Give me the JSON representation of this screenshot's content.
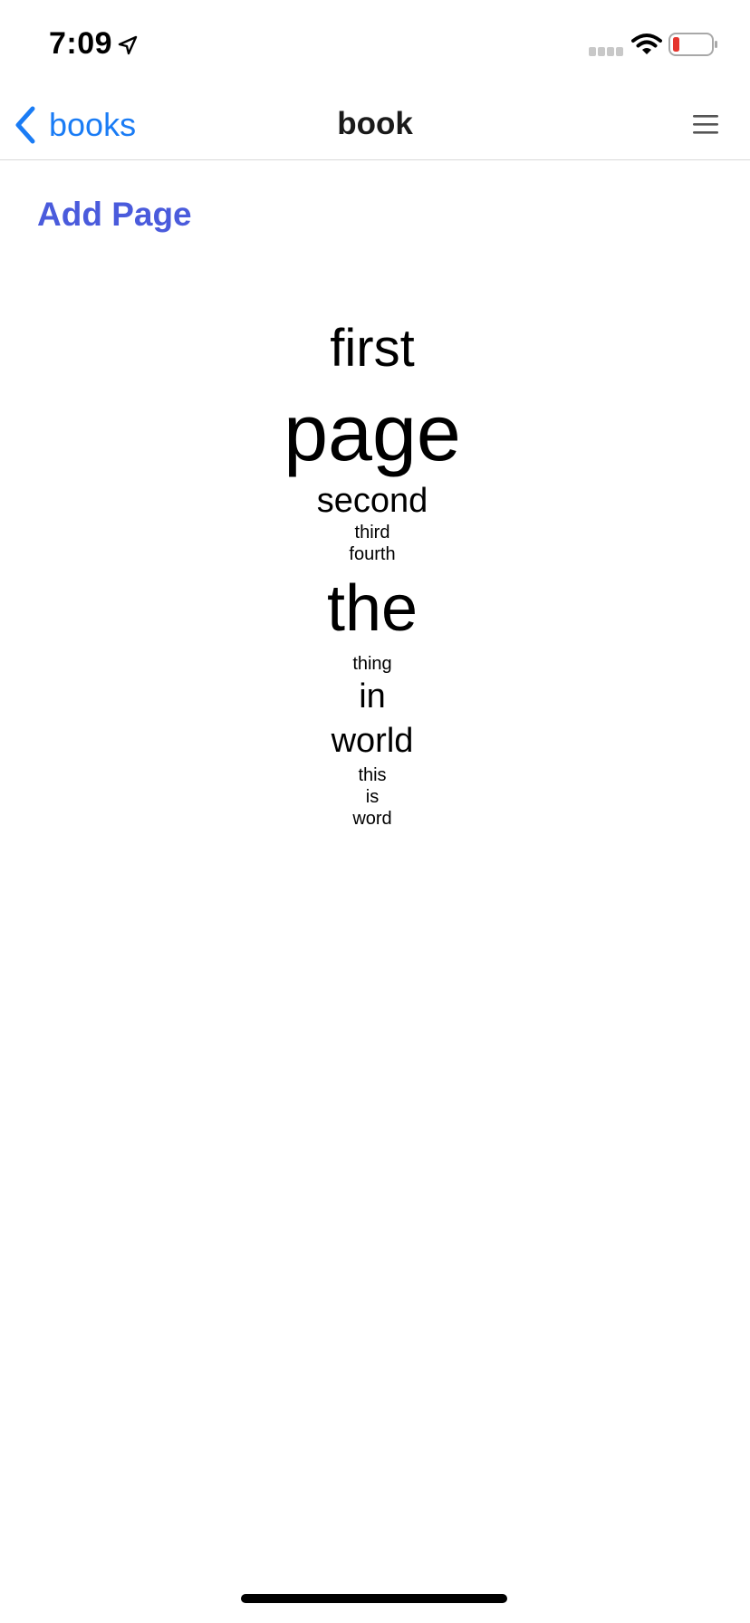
{
  "status_bar": {
    "time": "7:09",
    "icons": [
      "location-arrow-icon",
      "cellular-signal-icon",
      "wifi-icon",
      "battery-low-icon"
    ],
    "battery_color": "#e5352d"
  },
  "nav_bar": {
    "back_label": "books",
    "title": "book",
    "menu_icon": "hamburger-menu-icon",
    "tint_color": "#1a7cf5"
  },
  "content": {
    "add_page_label": "Add Page",
    "add_page_color": "#4a5bdc",
    "words": [
      "first",
      "page",
      "second",
      "third",
      "fourth",
      "the",
      "thing",
      "in",
      "world",
      "this",
      "is",
      "word"
    ]
  }
}
